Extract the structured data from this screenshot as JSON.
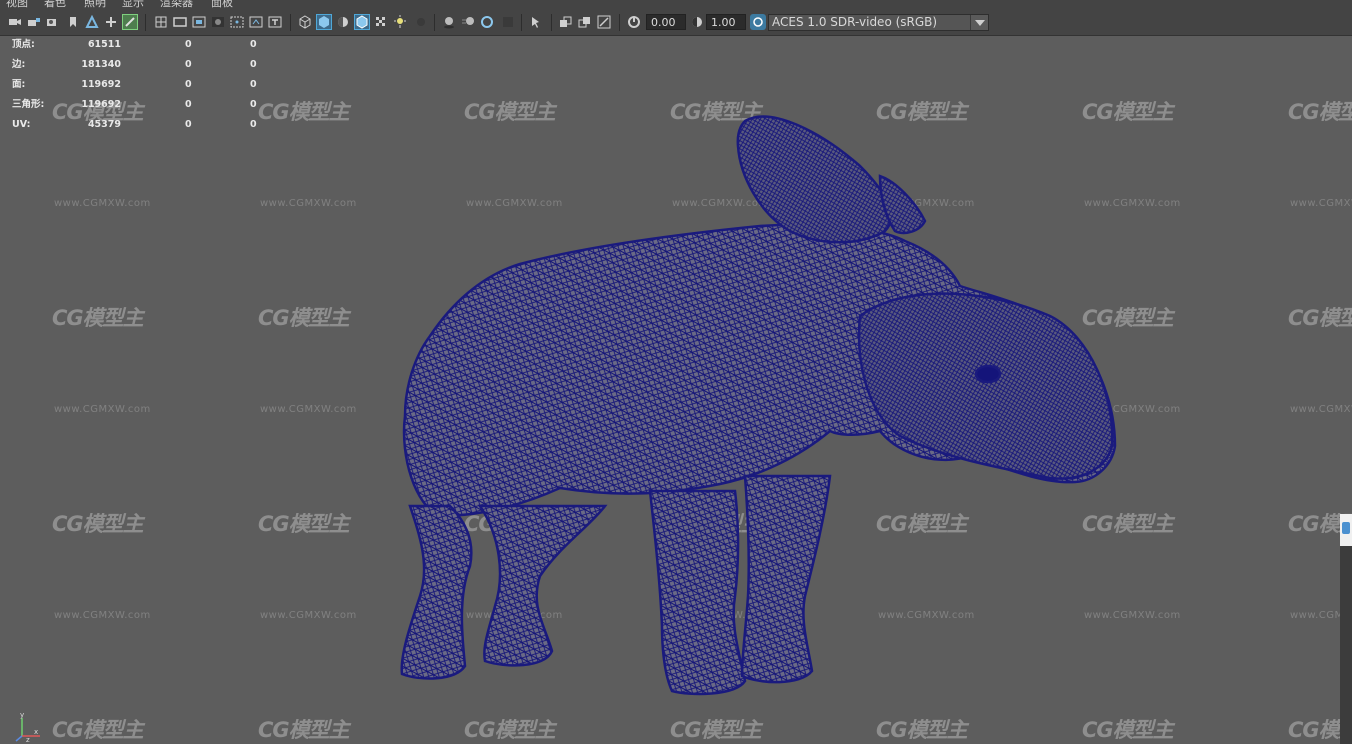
{
  "menubar": {
    "items": [
      "视图",
      "着色",
      "照明",
      "显示",
      "渲染器",
      "面板"
    ]
  },
  "toolbar": {
    "exposure_value": "0.00",
    "gamma_value": "1.00",
    "color_space": "ACES 1.0 SDR-video (sRGB)",
    "icons": [
      "camera-icon",
      "lock-camera-icon",
      "camera-attributes-icon",
      "bookmark-icon",
      "image-plane-icon",
      "2d-pan-zoom-icon",
      "grease-pencil-icon",
      "grid-icon",
      "film-gate-icon",
      "resolution-gate-icon",
      "gate-mask-icon",
      "field-chart-icon",
      "safe-action-icon",
      "safe-title-icon",
      "wireframe-icon",
      "smooth-shade-icon",
      "use-default-material-icon",
      "wireframe-on-shaded-icon",
      "xray-icon",
      "lights-icon",
      "shadows-icon",
      "screen-space-ao-icon",
      "motion-blur-icon",
      "multisample-aa-icon",
      "depth-of-field-icon",
      "isolate-select-icon",
      "xray-joints-icon",
      "xray-active-icon",
      "backface-culling-icon",
      "exposure-icon",
      "gamma-icon",
      "color-management-icon"
    ]
  },
  "hud": {
    "rows": [
      {
        "label": "顶点:",
        "v1": "61511",
        "v2": "0",
        "v3": "0"
      },
      {
        "label": "边:",
        "v1": "181340",
        "v2": "0",
        "v3": "0"
      },
      {
        "label": "面:",
        "v1": "119692",
        "v2": "0",
        "v3": "0"
      },
      {
        "label": "三角形:",
        "v1": "119692",
        "v2": "0",
        "v3": "0"
      },
      {
        "label": "UV:",
        "v1": "45379",
        "v2": "0",
        "v3": "0"
      }
    ]
  },
  "watermark": {
    "logo": "CG模型主",
    "url": "www.CGMXW.com"
  },
  "axis": {
    "x": "x",
    "y": "y",
    "z": "z"
  },
  "colors": {
    "viewport_bg": "#5d5d5d",
    "wireframe": "#1a1a7e",
    "toolbar_bg": "#444444",
    "active_icon": "#4fa8d8"
  }
}
